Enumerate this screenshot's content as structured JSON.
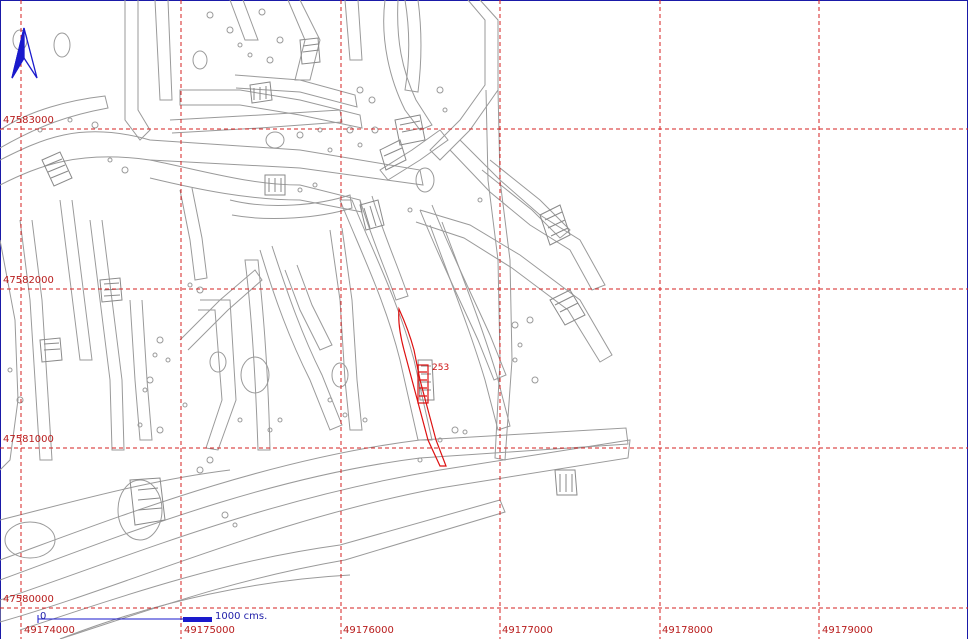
{
  "map": {
    "grid_x_labels": [
      "49174000",
      "49175000",
      "49176000",
      "49177000",
      "49178000",
      "49179000"
    ],
    "grid_y_labels": [
      "47583000",
      "47582000",
      "47581000",
      "47580000"
    ],
    "scale": {
      "zero": "0",
      "distance": "1000",
      "unit": "cms."
    },
    "north_arrow": "north-arrow-icon",
    "highlighted_feature": {
      "label": "253"
    },
    "colors": {
      "grid": "#d42020",
      "features": "#9a9a9a",
      "highlight": "#dd1111",
      "frame": "#1a1aa8",
      "scale_bar": "#1a1acc"
    }
  }
}
